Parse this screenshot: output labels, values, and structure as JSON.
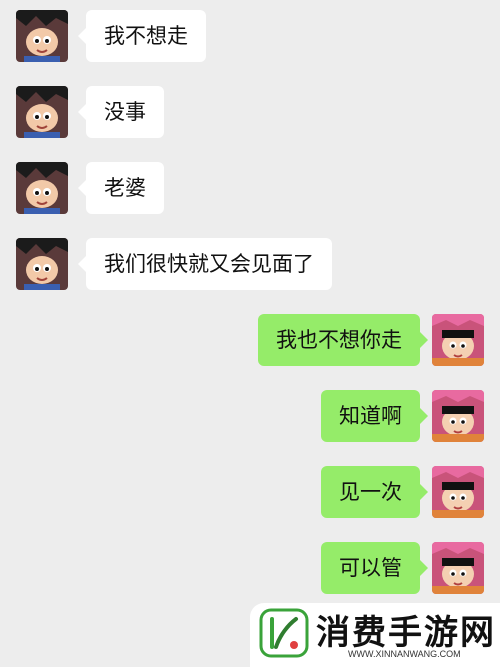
{
  "chat": {
    "messages": [
      {
        "side": "left",
        "text": "我不想走"
      },
      {
        "side": "left",
        "text": "没事"
      },
      {
        "side": "left",
        "text": "老婆"
      },
      {
        "side": "left",
        "text": "我们很快就又会见面了"
      },
      {
        "side": "right",
        "text": "我也不想你走"
      },
      {
        "side": "right",
        "text": "知道啊"
      },
      {
        "side": "right",
        "text": "见一次"
      },
      {
        "side": "right",
        "text": "可以管"
      }
    ]
  },
  "watermark": {
    "name": "消费手游网",
    "url": "WWW.XINNANWANG.COM"
  },
  "colors": {
    "background": "#ededed",
    "incoming_bubble": "#ffffff",
    "outgoing_bubble": "#95ec69",
    "brand_green": "#3aa33a"
  }
}
